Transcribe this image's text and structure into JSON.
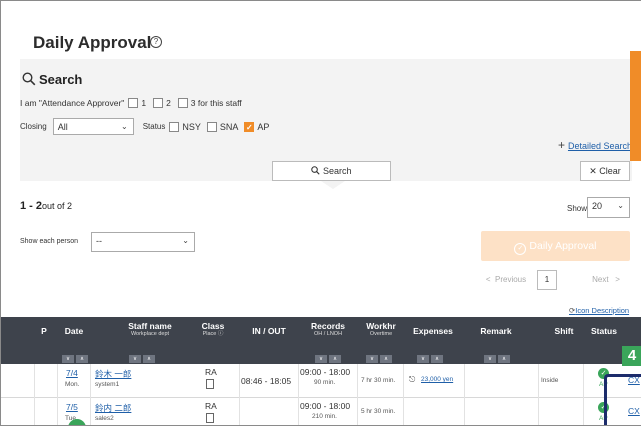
{
  "page": {
    "title": "Daily Approval"
  },
  "search": {
    "heading": "Search",
    "approver_prefix": "I am \"Attendance Approver\"",
    "approver_levels": [
      "1",
      "2",
      "3 for this staff"
    ],
    "closing_label": "Closing",
    "closing_value": "All",
    "status_label": "Status",
    "status_options": [
      {
        "label": "NSY",
        "checked": false
      },
      {
        "label": "SNA",
        "checked": false
      },
      {
        "label": "AP",
        "checked": true
      }
    ],
    "detail_link": "Detailed Search",
    "search_button": "Search",
    "clear_button": "Clear"
  },
  "results": {
    "range": "1 - 2",
    "of_total": "out of 2",
    "show_label": "Show",
    "show_value": "20",
    "person_label": "Show each person",
    "person_value": "--",
    "approve_button": "Daily Approval",
    "pagination": {
      "previous": "Previous",
      "page": "1",
      "next": "Next"
    },
    "icon_description": "Icon Description"
  },
  "table": {
    "headers": {
      "p": "P",
      "date": "Date",
      "staff": "Staff name",
      "staff_sub": "Workplace dept",
      "class": "Class",
      "class_sub": "Place ⓘ",
      "inout": "IN / OUT",
      "records": "Records",
      "records_sub": "OH / LNOH",
      "workhr": "Workhr",
      "workhr_sub": "Overtime",
      "expenses": "Expenses",
      "remark": "Remark",
      "shift": "Shift",
      "status": "Status"
    },
    "rows": [
      {
        "date": "7/4",
        "day": "Mon.",
        "name": "鈴木 一郎",
        "dept": "system1",
        "class": "RA",
        "inout": "08:46 - 18:05",
        "records": "09:00 - 18:00",
        "records_sub": "90 min.",
        "workhr": "7 hr 30 min.",
        "expense": "23,000 yen",
        "shift": "Inside",
        "status": "AP",
        "action": "CX"
      },
      {
        "date": "7/5",
        "day": "Tue.",
        "name": "鈴内 二郎",
        "dept": "sales2",
        "class": "RA",
        "inout": "",
        "records": "09:00 - 18:00",
        "records_sub": "210 min.",
        "workhr": "5 hr 30 min.",
        "expense": "",
        "shift": "",
        "status": "AP",
        "action": "CX"
      }
    ]
  },
  "callout": {
    "step": "4"
  },
  "colors": {
    "accent": "#f08c28",
    "header_bg": "#3e434c",
    "link": "#1f5fa8",
    "ok": "#3aa55a",
    "frame": "#1c2c6b"
  }
}
